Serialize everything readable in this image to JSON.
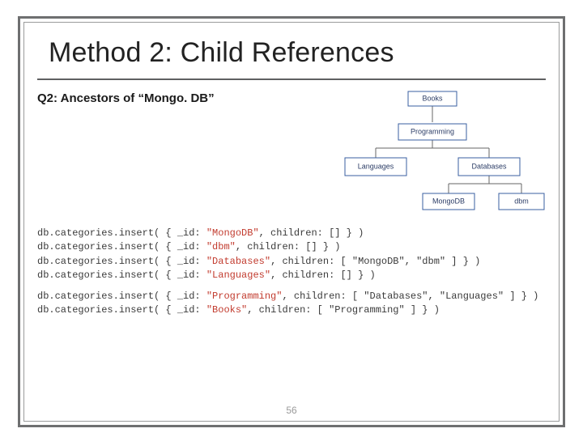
{
  "title": "Method 2: Child References",
  "subhead": "Q2: Ancestors of “Mongo. DB”",
  "tree": {
    "books": "Books",
    "programming": "Programming",
    "languages": "Languages",
    "databases": "Databases",
    "mongodb": "MongoDB",
    "dbm": "dbm"
  },
  "code": {
    "prefix": "db.categories.insert( { _id: ",
    "childPrefix": ", children: ",
    "suffix": " } )",
    "lines": [
      {
        "id": "\"MongoDB\"",
        "children": "[]"
      },
      {
        "id": "\"dbm\"",
        "children": "[]"
      },
      {
        "id": "\"Databases\"",
        "children": "[ \"MongoDB\", \"dbm\" ]"
      },
      {
        "id": "\"Languages\"",
        "children": "[]"
      }
    ],
    "lines2": [
      {
        "id": "\"Programming\"",
        "children": "[ \"Databases\", \"Languages\" ]"
      },
      {
        "id": "\"Books\"",
        "children": "[ \"Programming\" ]"
      }
    ]
  },
  "pageNumber": "56"
}
